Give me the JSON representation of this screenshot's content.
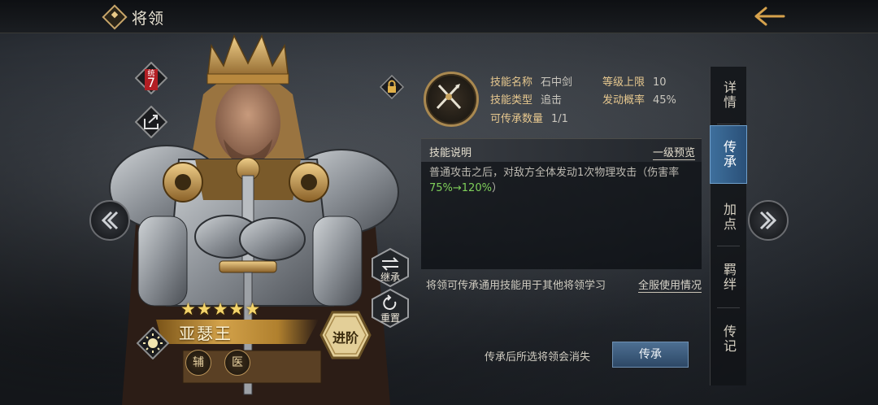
{
  "header": {
    "title": "将领"
  },
  "hero": {
    "name": "亚瑟王",
    "stars": "★★★★★",
    "rank_label": "统",
    "rank_value": "7",
    "tags": [
      "辅",
      "医"
    ]
  },
  "buttons": {
    "inherit_side": "继承",
    "reset": "重置",
    "advance": "进阶",
    "inherit_confirm": "传承"
  },
  "skill": {
    "name_label": "技能名称",
    "name_value": "石中剑",
    "type_label": "技能类型",
    "type_value": "追击",
    "count_label": "可传承数量",
    "count_value": "1/1",
    "level_label": "等级上限",
    "level_value": "10",
    "chance_label": "发动概率",
    "chance_value": "45%"
  },
  "description": {
    "title": "技能说明",
    "preview_link": "一级预览",
    "text_a": "普通攻击之后，对敌方全体发动1次物理攻击（伤害率",
    "text_hi": "75%→120%",
    "text_b": "）"
  },
  "footer": {
    "note": "将领可传承通用技能用于其他将领学习",
    "usage_link": "全服使用情况",
    "warning": "传承后所选将领会消失"
  },
  "tabs": [
    {
      "label": "详情"
    },
    {
      "label": "传承"
    },
    {
      "label": "加点"
    },
    {
      "label": "羁绊"
    },
    {
      "label": "传记"
    }
  ],
  "colors": {
    "accent_blue": "#3e6f9c",
    "gold": "#e7c88f",
    "highlight_green": "#7fd05a",
    "rank_red": "#b31f24"
  },
  "icons": {
    "back": "arrow-left-icon",
    "lock": "lock-icon",
    "skill": "crossed-swords-icon",
    "share": "share-icon",
    "sun": "sun-icon"
  }
}
